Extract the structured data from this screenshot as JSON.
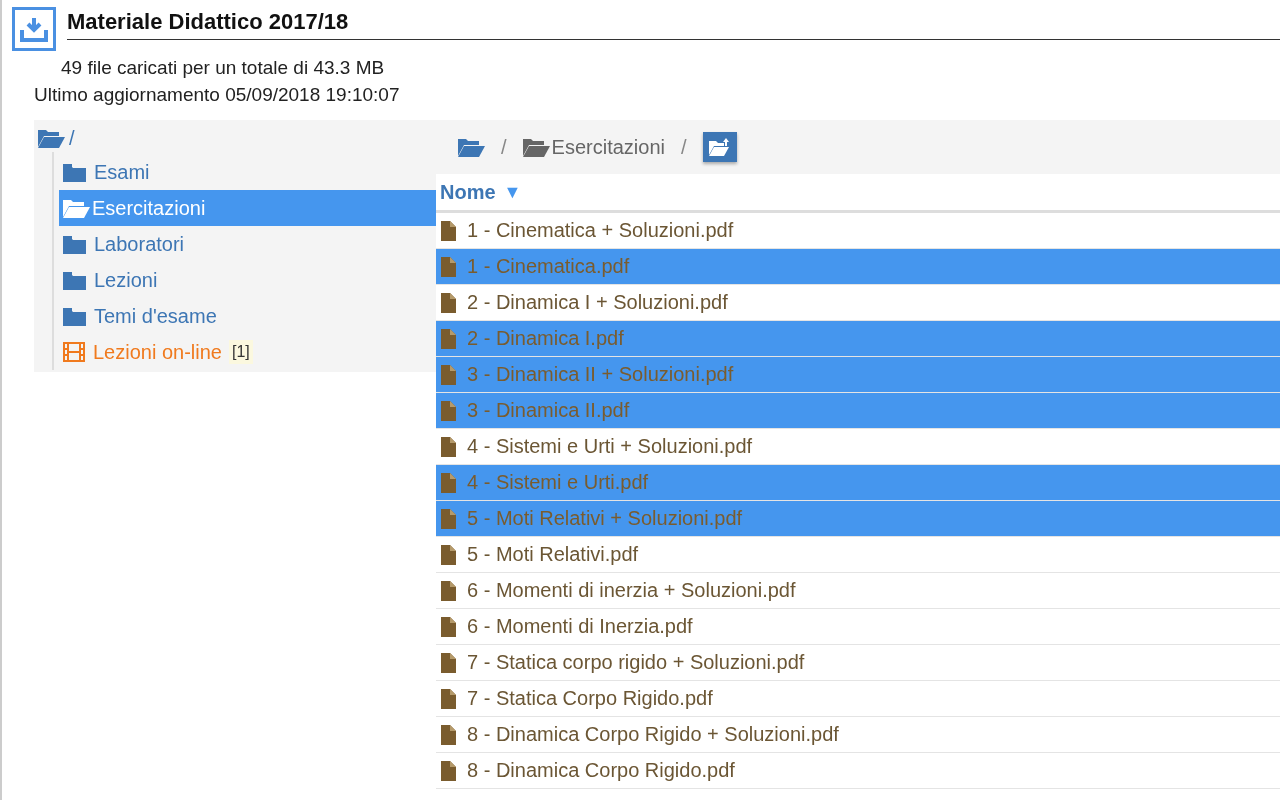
{
  "header": {
    "title": "Materiale Didattico 2017/18",
    "stats": "49 file caricati per un totale di 43.3 MB",
    "updated": "Ultimo aggiornamento 05/09/2018 19:10:07"
  },
  "tree": {
    "label": "/",
    "children": [
      {
        "label": "Esami",
        "kind": "folder",
        "selected": false
      },
      {
        "label": "Esercitazioni",
        "kind": "folder",
        "selected": true
      },
      {
        "label": "Laboratori",
        "kind": "folder",
        "selected": false
      },
      {
        "label": "Lezioni",
        "kind": "folder",
        "selected": false
      },
      {
        "label": "Temi d'esame",
        "kind": "folder",
        "selected": false
      },
      {
        "label": "Lezioni on-line",
        "kind": "video",
        "selected": false,
        "badge": "[1]"
      }
    ]
  },
  "breadcrumb": {
    "separator": "/",
    "items": [
      {
        "kind": "root"
      },
      {
        "kind": "folder",
        "label": "Esercitazioni"
      }
    ]
  },
  "table": {
    "columns": [
      {
        "label": "Nome",
        "sort_indicator": "▼"
      }
    ],
    "rows": [
      {
        "name": "1 - Cinematica + Soluzioni.pdf",
        "selected": false
      },
      {
        "name": "1 - Cinematica.pdf",
        "selected": true
      },
      {
        "name": "2 - Dinamica I + Soluzioni.pdf",
        "selected": false
      },
      {
        "name": "2 - Dinamica I.pdf",
        "selected": true
      },
      {
        "name": "3 - Dinamica II + Soluzioni.pdf",
        "selected": true
      },
      {
        "name": "3 - Dinamica II.pdf",
        "selected": true
      },
      {
        "name": "4 - Sistemi e Urti + Soluzioni.pdf",
        "selected": false
      },
      {
        "name": "4 - Sistemi e Urti.pdf",
        "selected": true
      },
      {
        "name": "5 - Moti Relativi + Soluzioni.pdf",
        "selected": true
      },
      {
        "name": "5 - Moti Relativi.pdf",
        "selected": false
      },
      {
        "name": "6 - Momenti di inerzia + Soluzioni.pdf",
        "selected": false
      },
      {
        "name": "6 - Momenti di Inerzia.pdf",
        "selected": false
      },
      {
        "name": "7 - Statica corpo rigido + Soluzioni.pdf",
        "selected": false
      },
      {
        "name": "7 - Statica Corpo Rigido.pdf",
        "selected": false
      },
      {
        "name": "8 - Dinamica Corpo Rigido + Soluzioni.pdf",
        "selected": false
      },
      {
        "name": "8 - Dinamica Corpo Rigido.pdf",
        "selected": false
      }
    ]
  }
}
